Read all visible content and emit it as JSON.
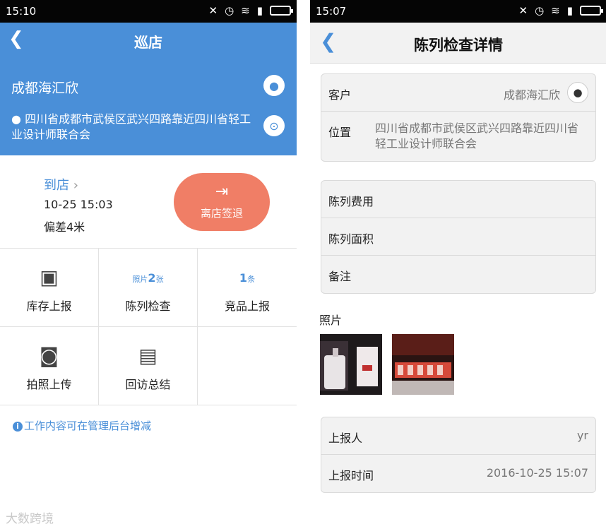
{
  "left": {
    "status_time": "15:10",
    "nav_title": "巡店",
    "store_name": "成都海汇欣",
    "address": "四川省成都市武侯区武兴四路靠近四川省轻工业设计师联合会",
    "arrive_label": "到店",
    "arrive_time": "10-25 15:03",
    "deviation": "偏差4米",
    "checkout_label": "离店签退",
    "tiles": [
      {
        "label": "库存上报",
        "icon": "box-icon"
      },
      {
        "label": "陈列检查",
        "count_prefix": "照片",
        "count": "2",
        "count_suffix": "张"
      },
      {
        "label": "竞品上报",
        "count": "1",
        "count_suffix": "条"
      },
      {
        "label": "拍照上传",
        "icon": "camera-icon"
      },
      {
        "label": "回访总结",
        "icon": "document-icon"
      }
    ],
    "note": "工作内容可在管理后台增减",
    "watermark": "大数跨境"
  },
  "right": {
    "status_time": "15:07",
    "nav_title": "陈列检查详情",
    "customer_label": "客户",
    "customer_value": "成都海汇欣",
    "location_label": "位置",
    "location_value": "四川省成都市武侯区武兴四路靠近四川省轻工业设计师联合会",
    "fee_label": "陈列费用",
    "area_label": "陈列面积",
    "remark_label": "备注",
    "photos_label": "照片",
    "reporter_label": "上报人",
    "reporter_value": "yr",
    "report_time_label": "上报时间",
    "report_time_value": "2016-10-25 15:07"
  },
  "colors": {
    "accent_blue": "#4a8fd8",
    "checkout_orange": "#f07e66"
  }
}
